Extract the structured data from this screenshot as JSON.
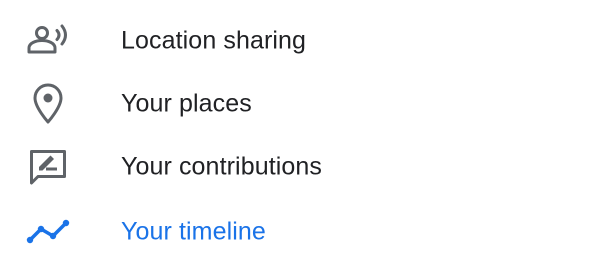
{
  "menu": {
    "items": [
      {
        "label": "Location sharing",
        "icon": "location-sharing-icon",
        "active": false
      },
      {
        "label": "Your places",
        "icon": "map-pin-icon",
        "active": false
      },
      {
        "label": "Your contributions",
        "icon": "contributions-icon",
        "active": false
      },
      {
        "label": "Your timeline",
        "icon": "timeline-icon",
        "active": true
      }
    ]
  },
  "colors": {
    "icon": "#5f6368",
    "text": "#202124",
    "accent": "#1a73e8",
    "background": "#ffffff"
  }
}
